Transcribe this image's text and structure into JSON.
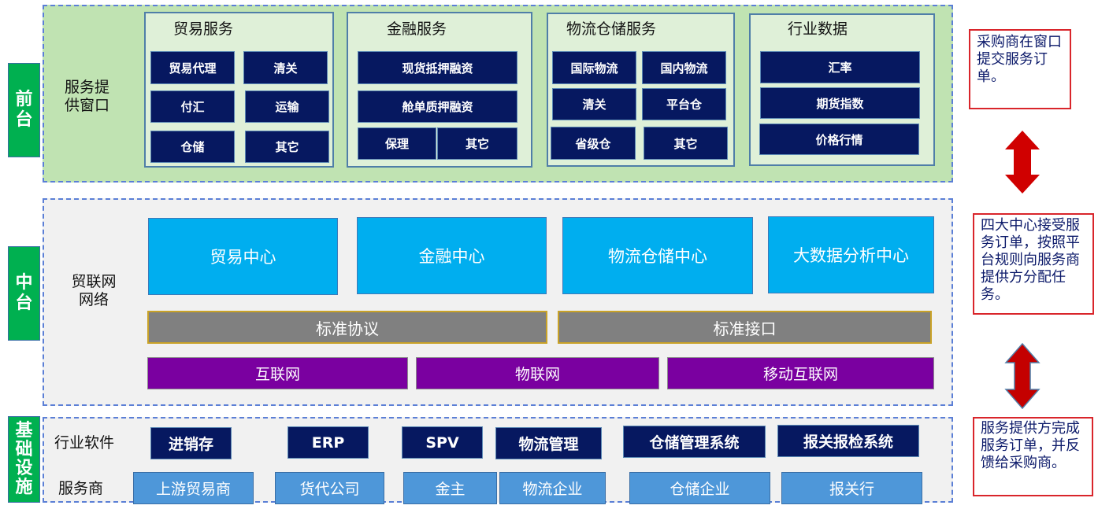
{
  "tiers": {
    "front": "前台",
    "middle": "中台",
    "base": "基础设施"
  },
  "front": {
    "label": "服务提供窗口",
    "groups": [
      {
        "title": "贸易服务",
        "items": [
          "贸易代理",
          "清关",
          "付汇",
          "运输",
          "仓储",
          "其它"
        ]
      },
      {
        "title": "金融服务",
        "items": [
          "现货抵押融资",
          "舱单质押融资",
          "保理",
          "其它"
        ]
      },
      {
        "title": "物流仓储服务",
        "items": [
          "国际物流",
          "国内物流",
          "清关",
          "平台仓",
          "省级仓",
          "其它"
        ]
      },
      {
        "title": "行业数据",
        "items": [
          "汇率",
          "期货指数",
          "价格行情"
        ]
      }
    ]
  },
  "middle": {
    "label": "贸联网网络",
    "centers": [
      "贸易中心",
      "金融中心",
      "物流仓储中心",
      "大数据分析中心"
    ],
    "standards": [
      "标准协议",
      "标准接口"
    ],
    "networks": [
      "互联网",
      "物联网",
      "移动互联网"
    ]
  },
  "base": {
    "software_label": "行业软件",
    "software": [
      "进销存",
      "ERP",
      "SPV",
      "物流管理",
      "仓储管理系统",
      "报关报检系统"
    ],
    "provider_label": "服务商",
    "providers": [
      "上游贸易商",
      "货代公司",
      "金主",
      "物流企业",
      "仓储企业",
      "报关行"
    ]
  },
  "notes": [
    "采购商在窗口提交服务订单。",
    "四大中心接受服务订单，按照平台规则向服务商提供方分配任务。",
    "服务提供方完成服务订单，并反馈给采购商。"
  ],
  "colors": {
    "tier_green": "#00b050",
    "nav_navy": "#061860",
    "center_blue": "#00aeef",
    "standard_gray": "#808080",
    "network_purple": "#7a00a0",
    "provider_blue": "#4e97d9",
    "note_red": "#d9252b",
    "arrow_red": "#d00000"
  }
}
